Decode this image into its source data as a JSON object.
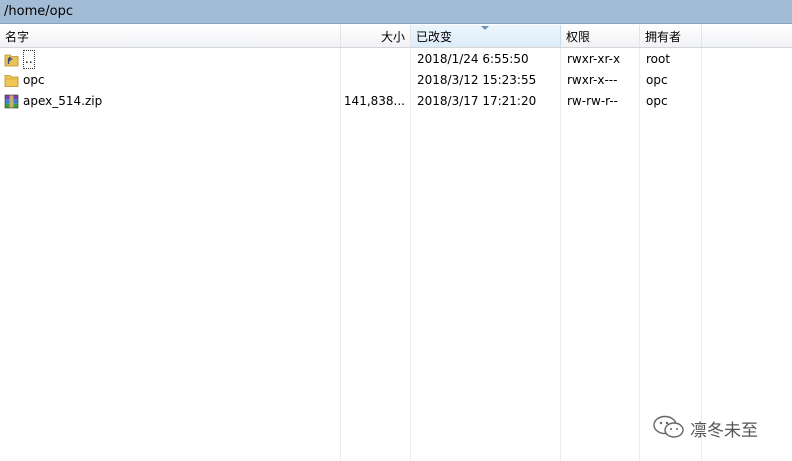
{
  "path": "/home/opc",
  "columns": {
    "name": "名字",
    "size": "大小",
    "modified": "已改变",
    "permissions": "权限",
    "owner": "拥有者"
  },
  "rows": [
    {
      "icon": "parent-folder-icon",
      "name": "..",
      "size": "",
      "modified": "2018/1/24 6:55:50",
      "permissions": "rwxr-xr-x",
      "owner": "root"
    },
    {
      "icon": "folder-icon",
      "name": "opc",
      "size": "",
      "modified": "2018/3/12 15:23:55",
      "permissions": "rwxr-x---",
      "owner": "opc"
    },
    {
      "icon": "zip-archive-icon",
      "name": "apex_514.zip",
      "size": "141,838...",
      "modified": "2018/3/17 17:21:20",
      "permissions": "rw-rw-r--",
      "owner": "opc"
    }
  ],
  "watermark": {
    "text": "凛冬未至",
    "icon": "wechat-icon"
  },
  "colors": {
    "path_bar": "#a3bcd6",
    "sorted_header": "#dcecf9"
  }
}
